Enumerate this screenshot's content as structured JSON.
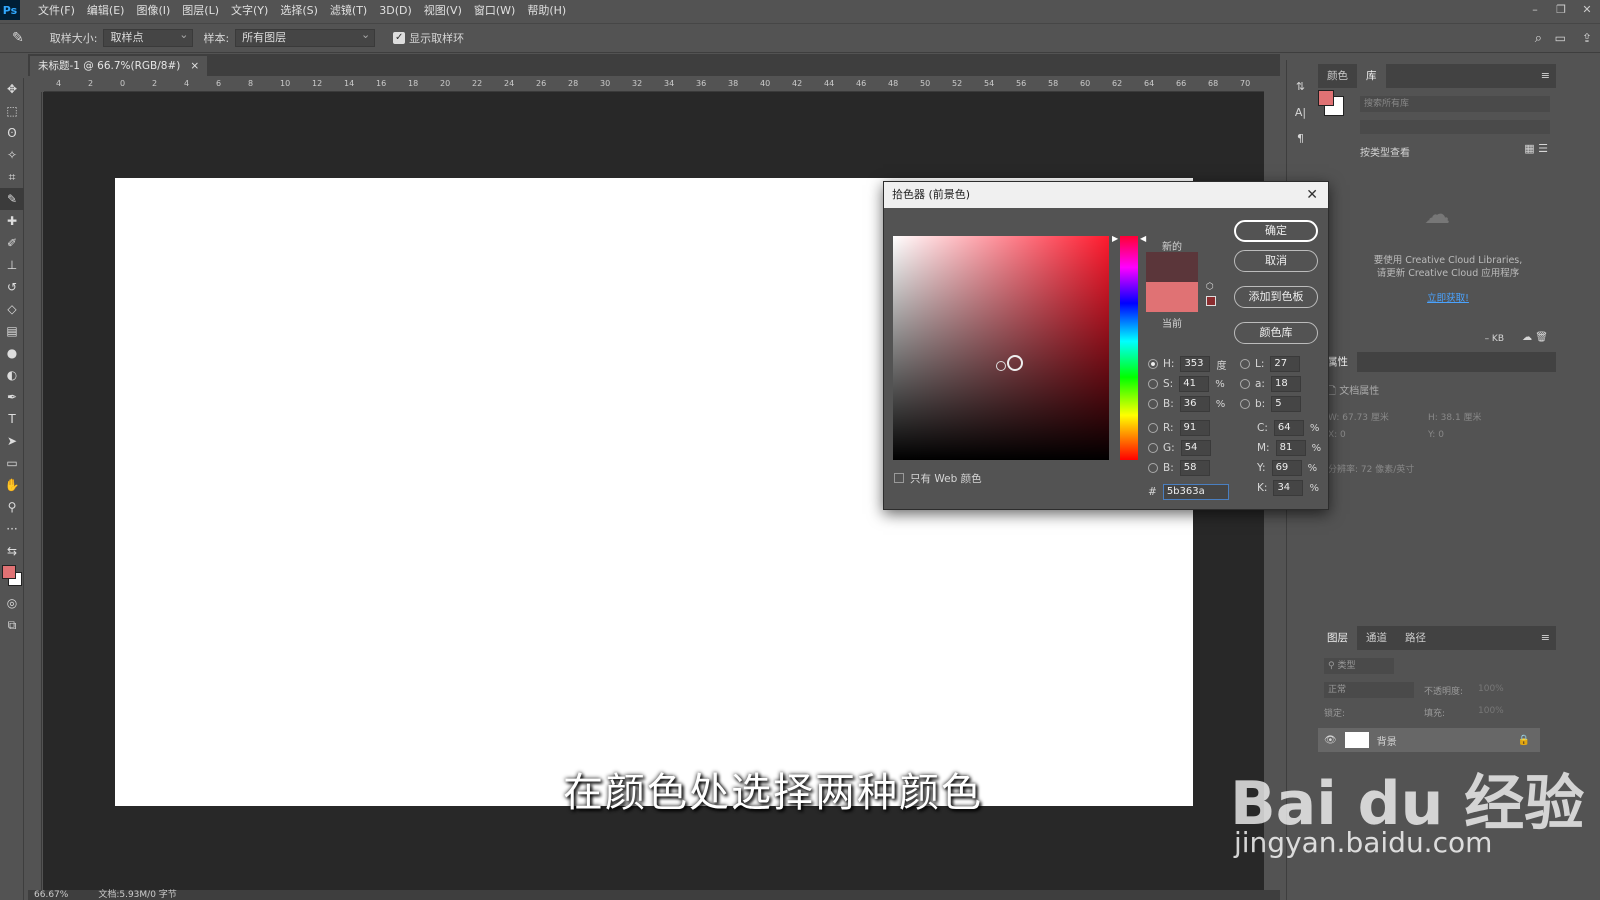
{
  "menubar": {
    "logo": "Ps",
    "items": [
      "文件(F)",
      "编辑(E)",
      "图像(I)",
      "图层(L)",
      "文字(Y)",
      "选择(S)",
      "滤镜(T)",
      "3D(D)",
      "视图(V)",
      "窗口(W)",
      "帮助(H)"
    ]
  },
  "options": {
    "sample_size_label": "取样大小:",
    "sample_size_value": "取样点",
    "sample_label": "样本:",
    "sample_value": "所有图层",
    "show_ring_label": "显示取样环"
  },
  "document": {
    "tab_title": "未标题-1 @ 66.7%(RGB/8#)",
    "close": "×"
  },
  "ruler": {
    "ticks": [
      "4",
      "2",
      "0",
      "2",
      "4",
      "6",
      "8",
      "10",
      "12",
      "14",
      "16",
      "18",
      "20",
      "22",
      "24",
      "26",
      "28",
      "30",
      "32",
      "34",
      "36",
      "38",
      "40",
      "42",
      "44",
      "46",
      "48",
      "50",
      "52",
      "54",
      "56",
      "58",
      "60",
      "62",
      "64",
      "66",
      "68",
      "70"
    ]
  },
  "status": {
    "zoom": "66.67%",
    "doc": "文档:5.93M/0 字节"
  },
  "color_picker": {
    "title": "拾色器 (前景色)",
    "close": "✕",
    "buttons": {
      "ok": "确定",
      "cancel": "取消",
      "add_swatch": "添加到色板",
      "libraries": "颜色库"
    },
    "new_label": "新的",
    "current_label": "当前",
    "new_color": "#5b363a",
    "current_color": "#e07274",
    "web_only_label": "只有 Web 颜色",
    "hsb": {
      "h": "353",
      "h_unit": "度",
      "s": "41",
      "b": "36",
      "pct": "%"
    },
    "rgb": {
      "r": "91",
      "g": "54",
      "b": "58"
    },
    "lab": {
      "l": "27",
      "a": "18",
      "b": "5"
    },
    "cmyk": {
      "c": "64",
      "m": "81",
      "y": "69",
      "k": "34"
    },
    "hex_prefix": "#",
    "hex": "5b363a",
    "labels": {
      "h": "H:",
      "s": "S:",
      "bb": "B:",
      "r": "R:",
      "g": "G:",
      "b": "B:",
      "l": "L:",
      "a": "a:",
      "lb": "b:",
      "c": "C:",
      "m": "M:",
      "y": "Y:",
      "k": "K:"
    }
  },
  "right_panel": {
    "tabs": [
      "颜色",
      "库"
    ],
    "search_placeholder": "搜索所有库",
    "view_by": "按类型查看",
    "cc_message_1": "要使用 Creative Cloud Libraries,",
    "cc_message_2": "请更新 Creative Cloud 应用程序",
    "cc_link": "立即获取!",
    "size": "– KB"
  },
  "properties": {
    "tab": "属性",
    "doc_props": "文档属性",
    "w": "W: 67.73 厘米",
    "h": "H: 38.1 厘米",
    "x": "X: 0",
    "y": "Y: 0",
    "resolution": "分辨率: 72 像素/英寸"
  },
  "layers": {
    "tabs": [
      "图层",
      "通道",
      "路径"
    ],
    "filter": "类型",
    "blend": "正常",
    "opacity_label": "不透明度:",
    "opacity": "100%",
    "lock_label": "锁定:",
    "fill_label": "填充:",
    "fill": "100%",
    "layer_name": "背景"
  },
  "subtitle": "在颜色处选择两种颜色",
  "watermark": {
    "brand": "Bai du 经验",
    "url": "jingyan.baidu.com"
  }
}
